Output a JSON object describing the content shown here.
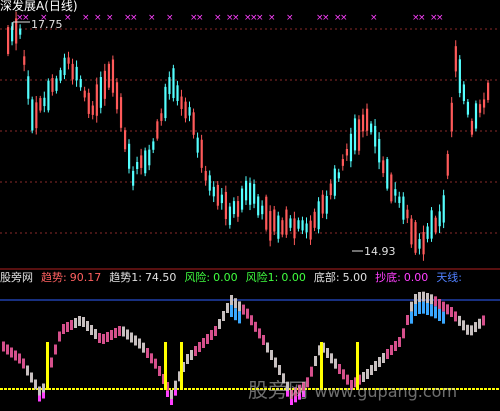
{
  "title": "深发展A(日线)",
  "high_label": "17.75",
  "low_label": "14.93",
  "indicator_bar": {
    "name": "股旁网",
    "trend_label": "趋势:",
    "trend_value": "90.17",
    "trend1_label": "趋势1:",
    "trend1_value": "74.50",
    "risk_label": "风险:",
    "risk_value": "0.00",
    "risk1_label": "风险1:",
    "risk1_value": "0.00",
    "bottom_label": "底部:",
    "bottom_value": "5.00",
    "chaodi_label": "抄底:",
    "chaodi_value": "0.00",
    "tianxian_label": "天线:"
  },
  "watermark": {
    "cn": "股旁网",
    "url": "www.gupang.com"
  },
  "colors": {
    "up_candle": "#ff5a5a",
    "down_candle": "#54ffff",
    "grid": "#8a2a2a",
    "marker": "#ff40ff",
    "top_line": "#3060ff",
    "bottom_line": "#ffff00",
    "osc_pink": "#d6508c",
    "osc_gray": "#c8c0c0",
    "trend_label": "#ff6060",
    "risk_label": "#40ff40",
    "bottom_label": "#e0e0e0",
    "chaodi_label": "#ff40ff",
    "tianxian_label": "#5080ff"
  }
}
